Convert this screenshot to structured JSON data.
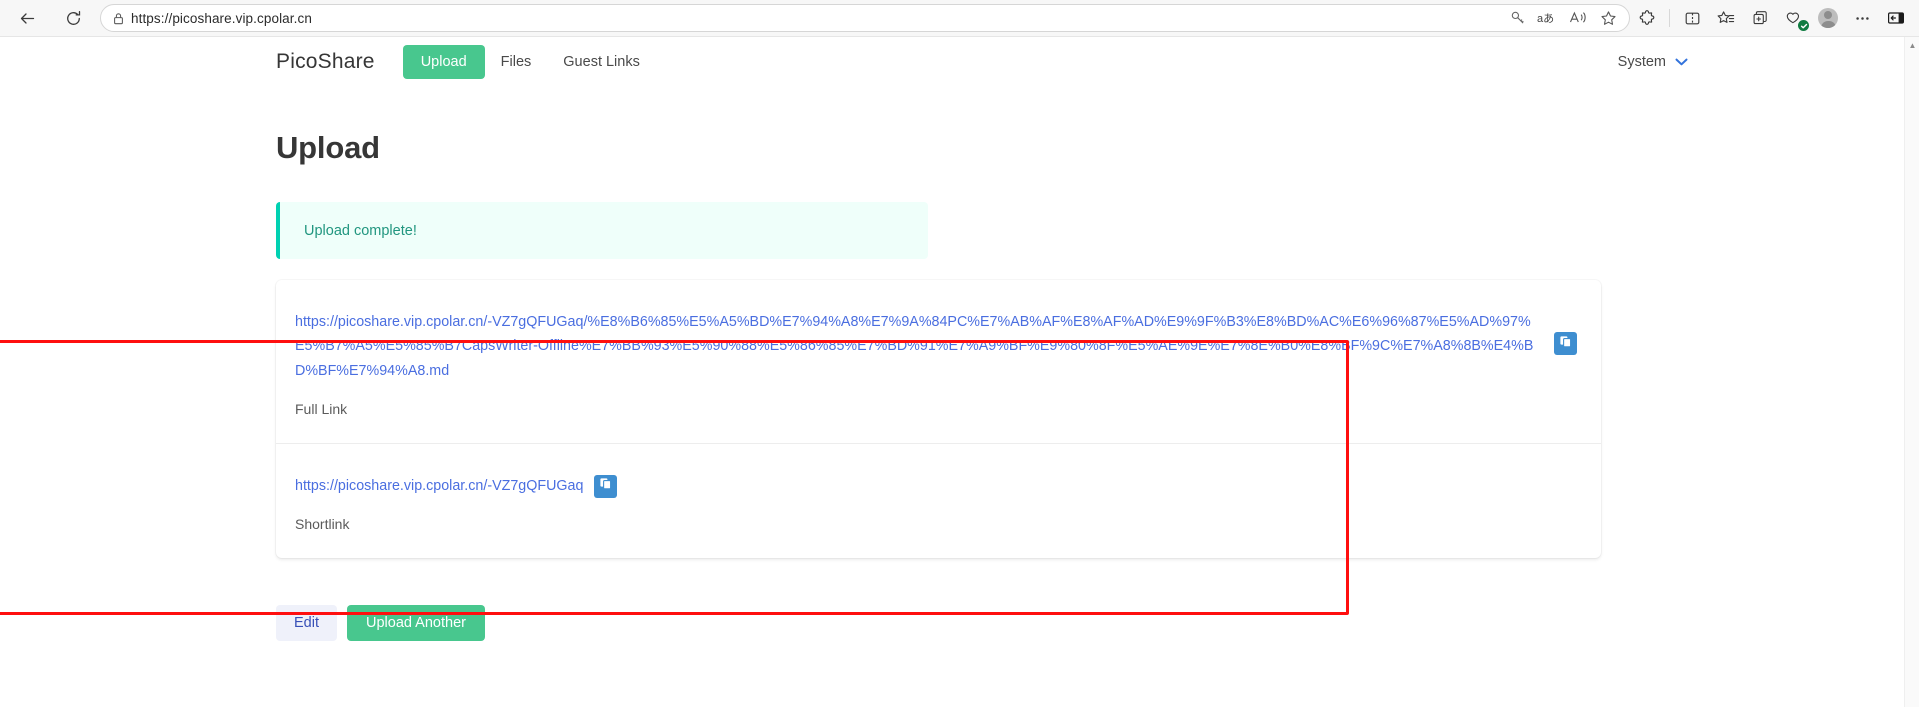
{
  "browser": {
    "back_icon": "back-arrow-icon",
    "reload_icon": "reload-icon",
    "lock_icon": "lock-icon",
    "url": "https://picoshare.vip.cpolar.cn",
    "url_scheme": "https://",
    "url_host": "picoshare.vip.cpolar.cn",
    "address_icons": [
      "key-icon",
      "translate-icon",
      "read-aloud-icon",
      "favorite-star-icon"
    ],
    "toolbar_icons": [
      "extensions-icon",
      "split-screen-icon",
      "favorites-icon",
      "collections-icon",
      "browser-essentials-icon",
      "profile-avatar-icon",
      "settings-more-icon",
      "sidebar-icon"
    ]
  },
  "nav": {
    "brand": "PicoShare",
    "upload_label": "Upload",
    "files_label": "Files",
    "guest_links_label": "Guest Links",
    "system_label": "System",
    "system_chevron": "chevron-down-icon"
  },
  "page": {
    "title": "Upload",
    "notification": "Upload complete!"
  },
  "links": {
    "full_link_url": "https://picoshare.vip.cpolar.cn/-VZ7gQFUGaq/%E8%B6%85%E5%A5%BD%E7%94%A8%E7%9A%84PC%E7%AB%AF%E8%AF%AD%E9%9F%B3%E8%BD%AC%E6%96%87%E5%AD%97%E5%B7%A5%E5%85%B7CapsWriter-Offline%E7%BB%93%E5%90%88%E5%86%85%E7%BD%91%E7%A9%BF%E9%80%8F%E5%AE%9E%E7%8E%B0%E8%BF%9C%E7%A8%8B%E4%BD%BF%E7%94%A8.md",
    "full_link_caption": "Full Link",
    "full_link_copy_icon": "copy-icon",
    "short_link_url": "https://picoshare.vip.cpolar.cn/-VZ7gQFUGaq",
    "short_link_caption": "Shortlink",
    "short_link_copy_icon": "copy-icon"
  },
  "actions": {
    "edit_label": "Edit",
    "upload_another_label": "Upload Another"
  },
  "colors": {
    "brand_green": "#48c78e",
    "link_blue": "#4a6ee0",
    "copy_button_blue": "#3e8ed0",
    "notification_bg": "#effffa",
    "notification_accent": "#00d1b2",
    "annotation_red": "#ff0f0f"
  },
  "scrollbar": {
    "up_arrow_icon": "scroll-up-arrow-icon"
  }
}
